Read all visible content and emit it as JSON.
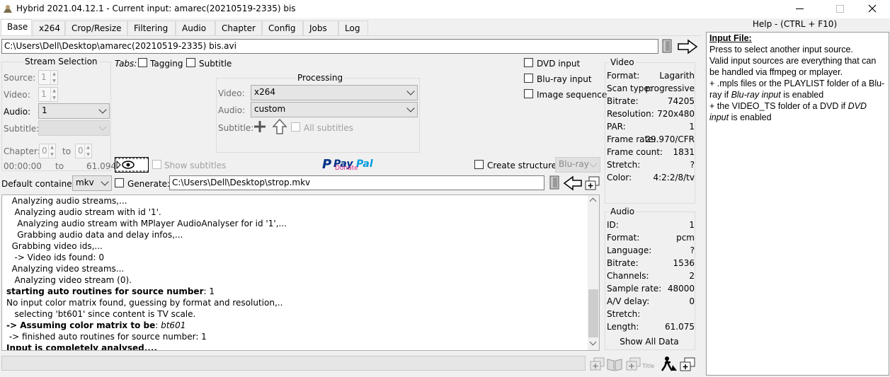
{
  "window": {
    "title": "Hybrid 2021.04.12.1 - Current input: amarec(20210519-2335) bis"
  },
  "tabs": [
    "Base",
    "x264",
    "Crop/Resize",
    "Filtering",
    "Audio",
    "Chapter",
    "Config",
    "Jobs",
    "Log"
  ],
  "input_path": "C:\\Users\\Dell\\Desktop\\amarec(20210519-2335) bis.avi",
  "stream_selection": {
    "title": "Stream Selection",
    "source_label": "Source:",
    "source_value": "1",
    "video_label": "Video:",
    "video_value": "1",
    "audio_label": "Audio:",
    "audio_value": "1",
    "subtitle_label": "Subtitle:",
    "subtitle_value": "",
    "chapter_label": "Chapter:",
    "chapter_from": "0",
    "to_label": "to",
    "chapter_to": "0",
    "time_start": "00:00:00",
    "time_to_label": "to",
    "time_end": "61.094"
  },
  "tabs_row": {
    "label": "Tabs:",
    "tagging": "Tagging",
    "subtitle": "Subtitle"
  },
  "processing": {
    "title": "Processing",
    "video_label": "Video:",
    "video_value": "x264",
    "audio_label": "Audio:",
    "audio_value": "custom",
    "subtitle_label": "Subtitle:",
    "all_subtitles": "All subtitles"
  },
  "input_options": {
    "dvd": "DVD input",
    "bluray": "Blu-ray input",
    "image_seq": "Image sequence"
  },
  "show_subtitles": "Show subtitles",
  "paypal": {
    "pay": "Pay",
    "pal": "Pal",
    "donate": "Donate"
  },
  "create_structure": {
    "label": "Create structure:",
    "value": "Blu-ray"
  },
  "container": {
    "label": "Default container:",
    "value": "mkv"
  },
  "generate": {
    "label": "Generate:",
    "path": "C:\\Users\\Dell\\Desktop\\strop.mkv"
  },
  "log_lines": [
    {
      "t": "  Analyzing audio streams,...",
      "style": "n"
    },
    {
      "t": "   Analyzing audio stream with id '1'.",
      "style": "n"
    },
    {
      "t": "    Analyzing audio stream with MPlayer AudioAnalyser for id '1',...",
      "style": "n"
    },
    {
      "t": "    Grabbing audio data and delay infos,...",
      "style": "n"
    },
    {
      "t": "  Grabbing video ids,...",
      "style": "n"
    },
    {
      "t": "   -> Video ids found: 0",
      "style": "n"
    },
    {
      "t": "  Analyzing video streams...",
      "style": "n"
    },
    {
      "t": "   Analyzing video stream (0).",
      "style": "n"
    },
    {
      "t": "starting auto routines for source number: 1",
      "style": "b1"
    },
    {
      "t": "No input color matrix found, guessing by format and resolution,..",
      "style": "n"
    },
    {
      "t": "   selecting 'bt601' since content is TV scale.",
      "style": "n"
    },
    {
      "t": "-> Assuming color matrix to be: bt601",
      "style": "b2"
    },
    {
      "t": " -> finished auto routines for source number: 1",
      "style": "n"
    },
    {
      "t": "Input is completely analysed,...",
      "style": "b"
    }
  ],
  "video_info": {
    "title": "Video",
    "rows": [
      {
        "k": "Format:",
        "v": "Lagarith"
      },
      {
        "k": "Scan type:",
        "v": "progressive"
      },
      {
        "k": "Bitrate:",
        "v": "74205"
      },
      {
        "k": "Resolution:",
        "v": "720x480"
      },
      {
        "k": "PAR:",
        "v": "1"
      },
      {
        "k": "Frame rate:",
        "v": "29.970/CFR"
      },
      {
        "k": "Frame count:",
        "v": "1831"
      },
      {
        "k": "Stretch:",
        "v": "?"
      },
      {
        "k": "Color:",
        "v": "4:2:2/8/tv"
      }
    ]
  },
  "audio_info": {
    "title": "Audio",
    "rows": [
      {
        "k": "ID:",
        "v": "1"
      },
      {
        "k": "Format:",
        "v": "pcm"
      },
      {
        "k": "Language:",
        "v": "?"
      },
      {
        "k": "Bitrate:",
        "v": "1536"
      },
      {
        "k": "Channels:",
        "v": "2"
      },
      {
        "k": "Sample rate:",
        "v": "48000"
      },
      {
        "k": "A/V delay:",
        "v": "0"
      },
      {
        "k": "Stretch:",
        "v": ""
      },
      {
        "k": "Length:",
        "v": "61.075"
      }
    ],
    "show_all": "Show All Data"
  },
  "bottom": {
    "title_label": "Title"
  },
  "help": {
    "header": "Help - (CTRL + F10)",
    "heading": "Input File:",
    "p1": "Press to select another input source.",
    "p2": "Valid input sources are everything that can be handled via ffmpeg or mplayer.",
    "p3": "+ .mpls files or the PLAYLIST folder of a Blu-ray if ",
    "p3_em": "Blu-ray input",
    "p3_end": " is enabled",
    "p4": "+ the VIDEO_TS folder of a DVD if ",
    "p4_em": "DVD input",
    "p4_end": " is enabled"
  }
}
